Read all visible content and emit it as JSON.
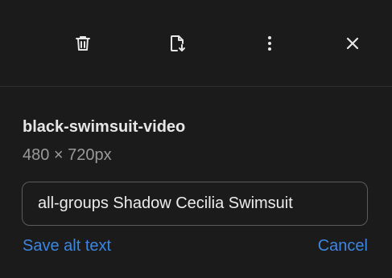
{
  "toolbar": {
    "icons": [
      "trash-icon",
      "file-download-icon",
      "more-vertical-icon",
      "close-icon"
    ],
    "icon_color": "#e6e6e6"
  },
  "media": {
    "title": "black-swimsuit-video",
    "dimensions": "480 × 720px"
  },
  "alt_text": {
    "value": "all-groups Shadow Cecilia Swimsuit"
  },
  "actions": {
    "save_label": "Save alt text",
    "cancel_label": "Cancel"
  },
  "colors": {
    "background": "#1b1b1b",
    "link": "#3d86e0",
    "secondary_text": "#9a9a9a"
  }
}
